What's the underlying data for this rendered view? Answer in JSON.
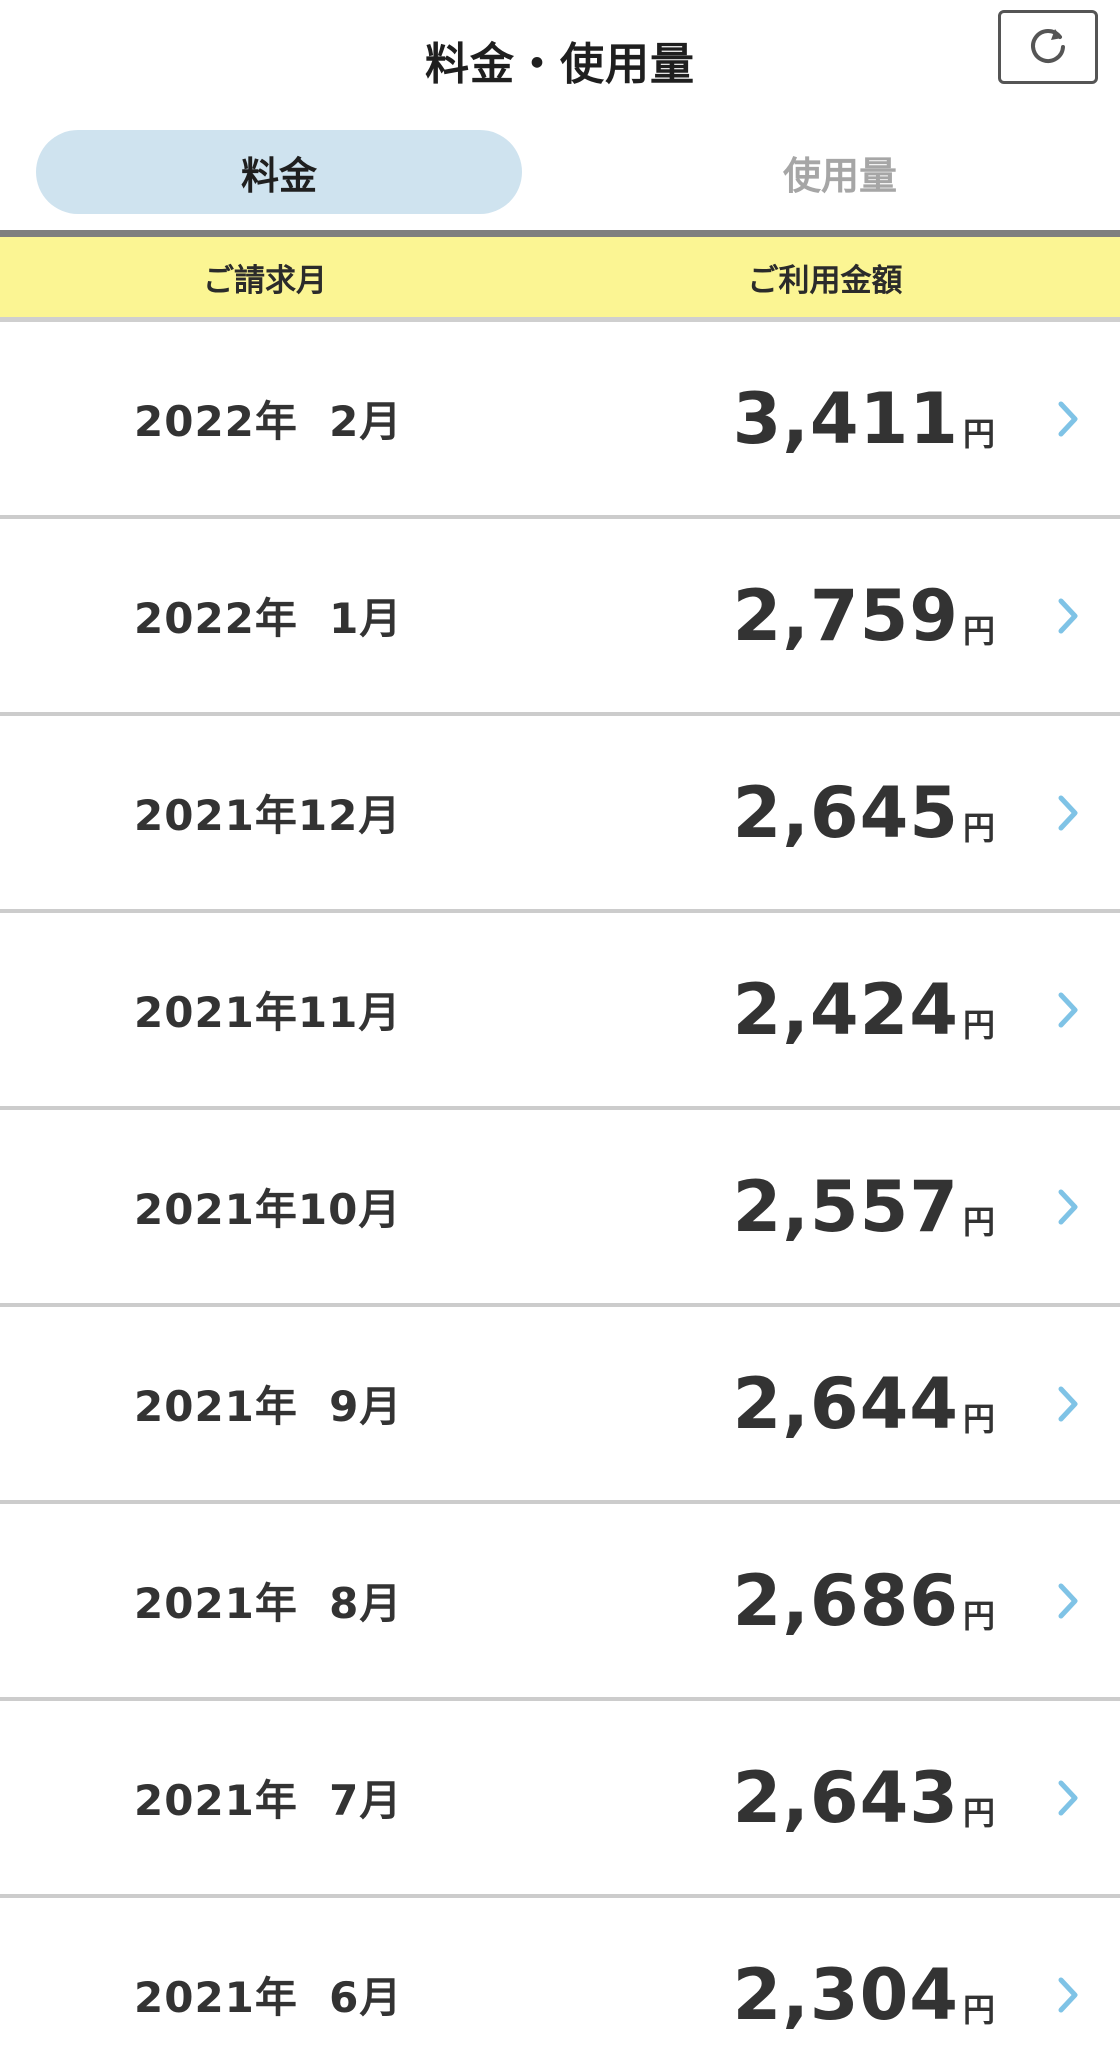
{
  "header": {
    "title": "料金・使用量"
  },
  "tabs": [
    {
      "label": "料金",
      "active": true
    },
    {
      "label": "使用量",
      "active": false
    }
  ],
  "table": {
    "columns": [
      "ご請求月",
      "ご利用金額"
    ],
    "currency_unit": "円",
    "rows": [
      {
        "month": "2022年  2月",
        "amount": "3,411"
      },
      {
        "month": "2022年  1月",
        "amount": "2,759"
      },
      {
        "month": "2021年12月",
        "amount": "2,645"
      },
      {
        "month": "2021年11月",
        "amount": "2,424"
      },
      {
        "month": "2021年10月",
        "amount": "2,557"
      },
      {
        "month": "2021年  9月",
        "amount": "2,644"
      },
      {
        "month": "2021年  8月",
        "amount": "2,686"
      },
      {
        "month": "2021年  7月",
        "amount": "2,643"
      },
      {
        "month": "2021年  6月",
        "amount": "2,304"
      }
    ]
  },
  "icons": {
    "refresh": "refresh-icon",
    "row_chevron": "chevron-right-icon"
  },
  "colors": {
    "active_tab_bg": "#cfe3ef",
    "table_header_bg": "#fbf593",
    "chevron": "#7fc3e6",
    "inactive_tab_text": "#a6a6a6"
  }
}
